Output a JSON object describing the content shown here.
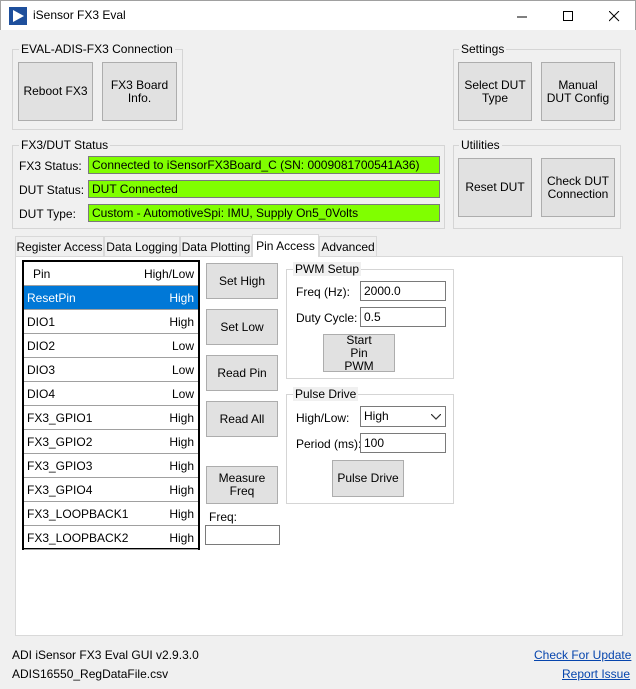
{
  "window": {
    "title": "iSensor FX3 Eval",
    "minimize_glyph": "—",
    "maximize_glyph": "☐",
    "close_glyph": "✕"
  },
  "connection": {
    "title": "EVAL-ADIS-FX3 Connection",
    "reboot_label": "Reboot FX3",
    "board_info_label": "FX3 Board Info."
  },
  "settings": {
    "title": "Settings",
    "select_dut_label": "Select DUT Type",
    "manual_config_label": "Manual DUT Config"
  },
  "status": {
    "title": "FX3/DUT Status",
    "fx3_label": "FX3 Status:",
    "fx3_value": "Connected to iSensorFX3Board_C (SN: 0009081700541A36)",
    "dut_label": "DUT Status:",
    "dut_value": "DUT Connected",
    "type_label": "DUT Type:",
    "type_value": "Custom - AutomotiveSpi: IMU, Supply On5_0Volts",
    "ok_color": "#80ff00"
  },
  "utilities": {
    "title": "Utilities",
    "reset_label": "Reset DUT",
    "check_label": "Check DUT Connection"
  },
  "tabs": [
    {
      "label": "Register Access"
    },
    {
      "label": "Data Logging"
    },
    {
      "label": "Data Plotting"
    },
    {
      "label": "Pin Access"
    },
    {
      "label": "Advanced"
    }
  ],
  "pins": {
    "header_pin": "Pin",
    "header_state": "High/Low",
    "rows": [
      {
        "pin": "ResetPin",
        "state": "High"
      },
      {
        "pin": "DIO1",
        "state": "High"
      },
      {
        "pin": "DIO2",
        "state": "Low"
      },
      {
        "pin": "DIO3",
        "state": "Low"
      },
      {
        "pin": "DIO4",
        "state": "Low"
      },
      {
        "pin": "FX3_GPIO1",
        "state": "High"
      },
      {
        "pin": "FX3_GPIO2",
        "state": "High"
      },
      {
        "pin": "FX3_GPIO3",
        "state": "High"
      },
      {
        "pin": "FX3_GPIO4",
        "state": "High"
      },
      {
        "pin": "FX3_LOOPBACK1",
        "state": "High"
      },
      {
        "pin": "FX3_LOOPBACK2",
        "state": "High"
      }
    ]
  },
  "pin_actions": {
    "set_high": "Set High",
    "set_low": "Set Low",
    "read_pin": "Read Pin",
    "read_all": "Read All",
    "measure_freq": "Measure Freq",
    "freq_label": "Freq:",
    "freq_value": ""
  },
  "pwm": {
    "title": "PWM Setup",
    "freq_label": "Freq (Hz):",
    "freq_value": "2000.0",
    "duty_label": "Duty Cycle:",
    "duty_value": "0.5",
    "start_label": "Start Pin PWM"
  },
  "pulse": {
    "title": "Pulse Drive",
    "level_label": "High/Low:",
    "level_value": "High",
    "period_label": "Period (ms):",
    "period_value": "100",
    "drive_label": "Pulse Drive"
  },
  "footer": {
    "version": "ADI iSensor FX3 Eval GUI v2.9.3.0",
    "file": "ADIS16550_RegDataFile.csv",
    "check_update": "Check For Update",
    "report_issue": "Report Issue"
  },
  "colors": {
    "selection": "#0078d7",
    "status_ok": "#80ff00",
    "link": "#0645ad"
  }
}
